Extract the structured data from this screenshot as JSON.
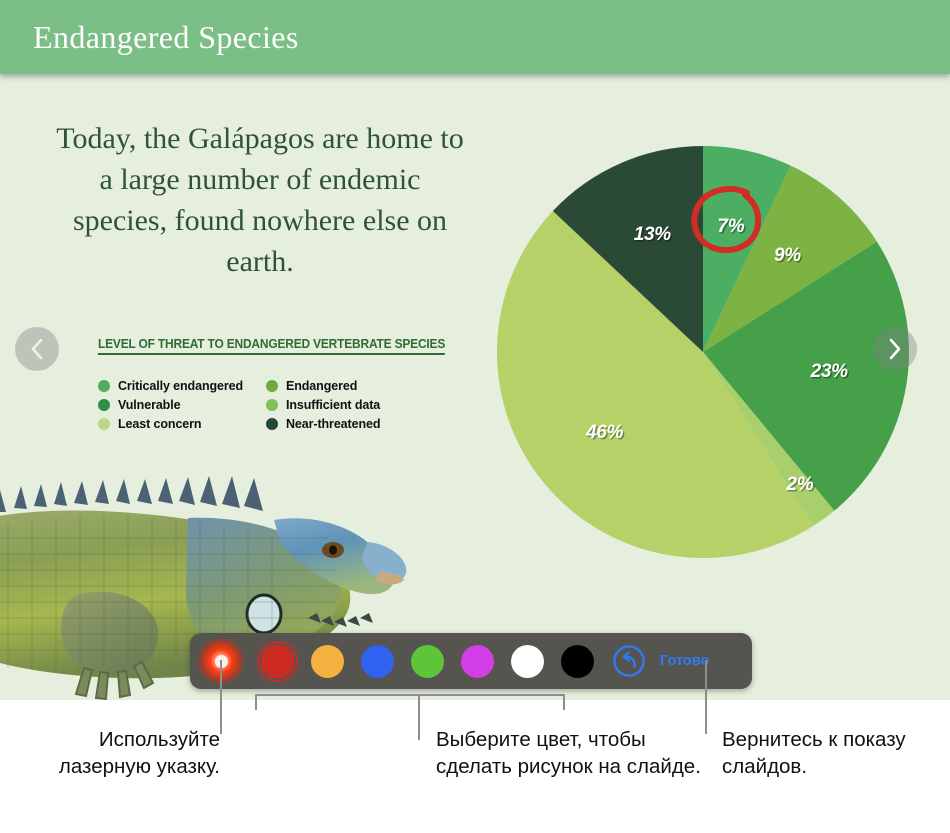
{
  "slide": {
    "title": "Endangered Species",
    "body": "Today, the Galápagos are home to a large number of endemic species, found nowhere else on earth.",
    "background_color": "#e6eede",
    "title_bar_color": "#7bbe86",
    "photo_name": "green-iguana-photo"
  },
  "chart_data": {
    "type": "pie",
    "title": "LEVEL OF THREAT TO ENDANGERED VERTEBRATE SPECIES",
    "categories": [
      "Critically endangered",
      "Endangered",
      "Vulnerable",
      "Insufficient data",
      "Least concern",
      "Near-threatened"
    ],
    "values": [
      7,
      9,
      23,
      2,
      46,
      13
    ],
    "labels": [
      "7%",
      "9%",
      "23%",
      "2%",
      "46%",
      "13%"
    ],
    "colors": [
      "#4cae62",
      "#7cb342",
      "#45a049",
      "#a9cf6c",
      "#b5d168",
      "#2b4a35"
    ],
    "legend": [
      {
        "label": "Critically endangered",
        "color": "#4cae62"
      },
      {
        "label": "Endangered",
        "color": "#6ea83f"
      },
      {
        "label": "Vulnerable",
        "color": "#2f8f44"
      },
      {
        "label": "Insufficient data",
        "color": "#79c25c"
      },
      {
        "label": "Least concern",
        "color": "#bcd585"
      },
      {
        "label": "Near-threatened",
        "color": "#24493a"
      }
    ],
    "legend_position": "below-title",
    "grid": false,
    "annotation": {
      "name": "red-ink-circle",
      "targets": "7%",
      "color": "#d32b25"
    }
  },
  "nav": {
    "previous_icon": "chevron-left-icon",
    "next_icon": "chevron-right-icon"
  },
  "toolbar": {
    "laser_pointer_name": "laser-pointer-tool",
    "swatches": [
      {
        "name": "color-red",
        "color": "#cf2a22",
        "selected": true
      },
      {
        "name": "color-orange",
        "color": "#f3b23f",
        "selected": false
      },
      {
        "name": "color-blue",
        "color": "#2f62ef",
        "selected": false
      },
      {
        "name": "color-green",
        "color": "#5ec43a",
        "selected": false
      },
      {
        "name": "color-magenta",
        "color": "#d43ee8",
        "selected": false
      },
      {
        "name": "color-white",
        "color": "#ffffff",
        "selected": false
      },
      {
        "name": "color-black",
        "color": "#000000",
        "selected": false
      }
    ],
    "undo_icon": "undo-arrow-icon",
    "done_label": "Готово",
    "accent_color": "#2f7bf6",
    "background_color": "#56544e"
  },
  "callouts": [
    {
      "text": "Используйте лазерную указку."
    },
    {
      "text": "Выберите цвет, чтобы сделать рисунок на слайде."
    },
    {
      "text": "Вернитесь к показу слайдов."
    }
  ]
}
